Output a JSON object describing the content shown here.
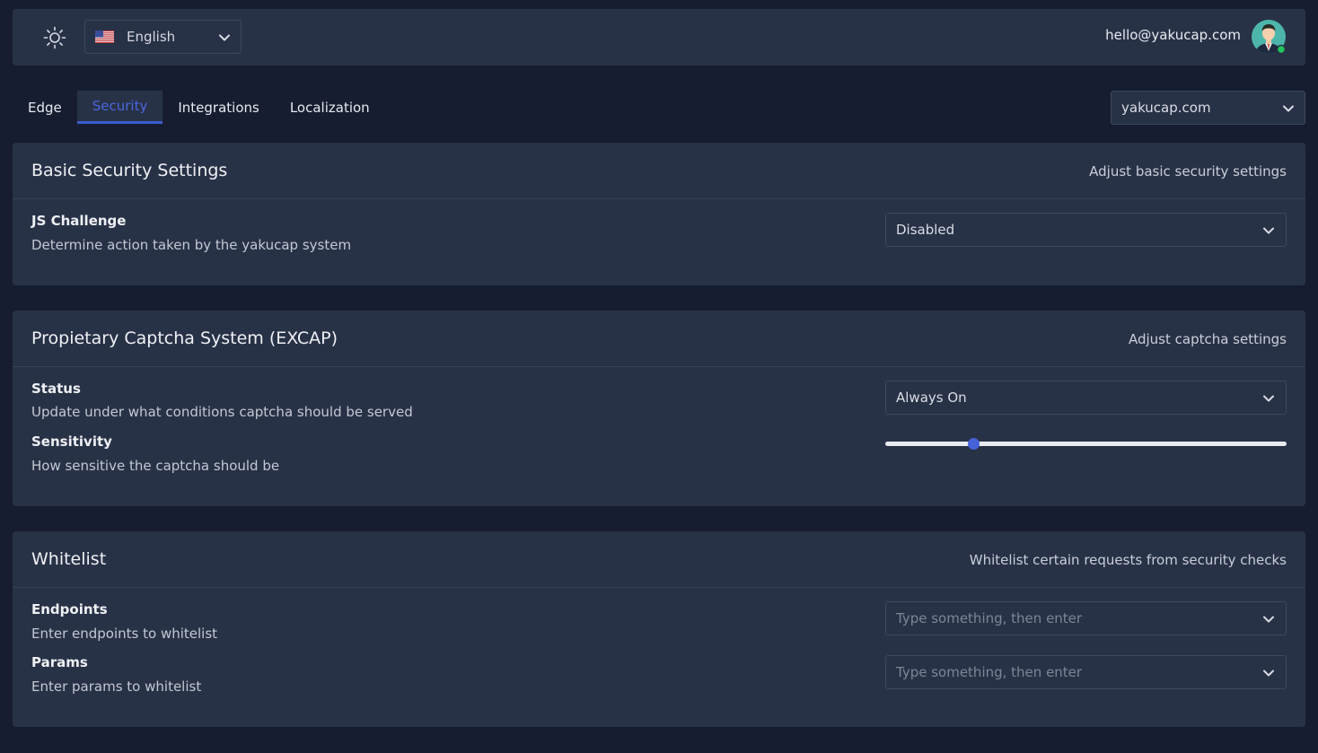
{
  "topbar": {
    "language": "English",
    "email": "hello@yakucap.com"
  },
  "tabs": [
    {
      "label": "Edge",
      "active": false
    },
    {
      "label": "Security",
      "active": true
    },
    {
      "label": "Integrations",
      "active": false
    },
    {
      "label": "Localization",
      "active": false
    }
  ],
  "domain_select": {
    "value": "yakucap.com"
  },
  "basic_security": {
    "title": "Basic Security Settings",
    "subtitle": "Adjust basic security settings",
    "js_challenge": {
      "label": "JS Challenge",
      "description": "Determine action taken by the yakucap system",
      "value": "Disabled"
    }
  },
  "captcha": {
    "title": "Propietary Captcha System (EXCAP)",
    "subtitle": "Adjust captcha settings",
    "status": {
      "label": "Status",
      "description": "Update under what conditions captcha should be served",
      "value": "Always On"
    },
    "sensitivity": {
      "label": "Sensitivity",
      "description": "How sensitive the captcha should be",
      "level": 0.22
    }
  },
  "whitelist": {
    "title": "Whitelist",
    "subtitle": "Whitelist certain requests from security checks",
    "endpoints": {
      "label": "Endpoints",
      "description": "Enter endpoints to whitelist",
      "placeholder": "Type something, then enter"
    },
    "params": {
      "label": "Params",
      "description": "Enter params to whitelist",
      "placeholder": "Type something, then enter"
    }
  },
  "colors": {
    "accent": "#3d5bd0",
    "background": "#161d30",
    "card": "#283247",
    "online": "#22c55e"
  }
}
